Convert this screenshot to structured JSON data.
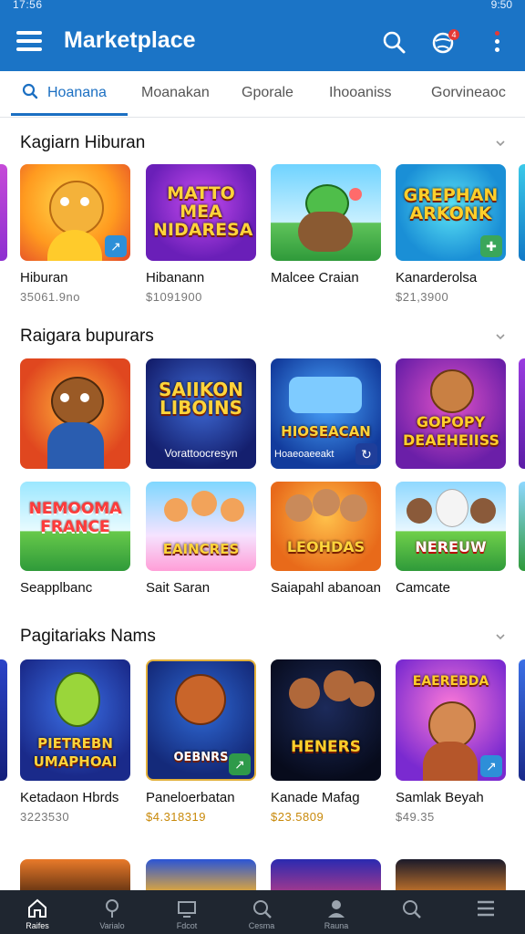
{
  "status_bar": {
    "time": "17:56",
    "clock": "9:50"
  },
  "app_bar": {
    "title": "Marketplace",
    "notification_count": "4"
  },
  "tabs": [
    {
      "label": "Hoanana",
      "active": true
    },
    {
      "label": "Moanakan",
      "active": false
    },
    {
      "label": "Gporale",
      "active": false
    },
    {
      "label": "Ihooaniss",
      "active": false
    },
    {
      "label": "Gorvineaoc",
      "active": false
    }
  ],
  "sections": [
    {
      "title": "Kagiarn Hiburan"
    },
    {
      "title": "Raigara bupurars"
    },
    {
      "title": "Pagitariaks Nams"
    }
  ],
  "row1": [
    {
      "name": "Hiburan",
      "price": "35061.9no",
      "banner": ""
    },
    {
      "name": "Hibanann",
      "price": "$1091900",
      "banner": "MATTO MEA NIDARESA"
    },
    {
      "name": "Malcee Craian",
      "price": "",
      "banner": ""
    },
    {
      "name": "Kanarderolsa",
      "price": "$21,3900",
      "banner": "GREPHAN ARKONK"
    }
  ],
  "row2": [
    {
      "name": "",
      "price": "",
      "banner": ""
    },
    {
      "name": "Vorattoocresyn",
      "price": "",
      "banner": "SAIIKON LIBOINS"
    },
    {
      "name": "Hoaeoaeeakt",
      "price": "",
      "banner": "HIOSEACAN"
    },
    {
      "name": "",
      "price": "",
      "banner": "GOPOPY DEAEHEIISS"
    }
  ],
  "row3": [
    {
      "name": "Seapplbanc",
      "price": "",
      "banner": "NEMOOMA FRANCE"
    },
    {
      "name": "Sait Saran",
      "price": "",
      "banner": "EAINCRES"
    },
    {
      "name": "Saiapahl abanoan",
      "price": "",
      "banner": "LEOHDAS"
    },
    {
      "name": "Camcate",
      "price": "",
      "banner": "NEREUW"
    }
  ],
  "row4": [
    {
      "name": "Ketadaon Hbrds",
      "price": "3223530",
      "banner": "PIETREBN UMAPHOAI"
    },
    {
      "name": "Paneloerbatan",
      "price": "$4.318319",
      "banner": "OEBNRS"
    },
    {
      "name": "Kanade Mafag",
      "price": "$23.5809",
      "banner": "HENERS"
    },
    {
      "name": "Samlak Beyah",
      "price": "$49.35",
      "banner": "EAEREBDA"
    }
  ],
  "bottom_nav": [
    {
      "label": "Raifes",
      "icon": "home-icon",
      "active": true
    },
    {
      "label": "Varialo",
      "icon": "lightbulb-icon",
      "active": false
    },
    {
      "label": "Fdcot",
      "icon": "tv-icon",
      "active": false
    },
    {
      "label": "Cesma",
      "icon": "search-icon",
      "active": false
    },
    {
      "label": "Rauna",
      "icon": "person-icon",
      "active": false
    },
    {
      "label": "",
      "icon": "search-icon",
      "active": false
    },
    {
      "label": "",
      "icon": "menu-icon",
      "active": false
    }
  ]
}
